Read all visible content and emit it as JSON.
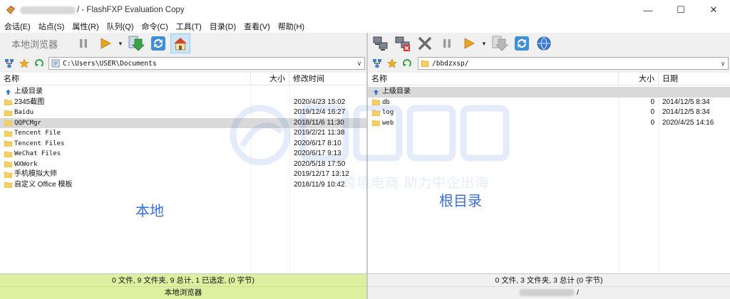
{
  "window": {
    "title": "/ - FlashFXP Evaluation Copy",
    "controls": [
      "—",
      "☐",
      "✕"
    ]
  },
  "menu": [
    "会话(E)",
    "站点(S)",
    "属性(R)",
    "队列(Q)",
    "命令(C)",
    "工具(T)",
    "目录(D)",
    "查看(V)",
    "帮助(H)"
  ],
  "colors": {
    "accent": "#3b6fd6",
    "status_left": "#dcf0a0",
    "selected_row": "#d9d9d9",
    "folder": "#f5cf63"
  },
  "left": {
    "toolbar_label": "本地浏览器",
    "path": "C:\\Users\\USER\\Documents",
    "columns": {
      "name": "名称",
      "size": "大小",
      "modified": "修改时间"
    },
    "rows": [
      {
        "name": "上级目录",
        "size": "",
        "date": "",
        "type": "up"
      },
      {
        "name": "2345截图",
        "size": "",
        "date": "2020/4/23 15:02",
        "type": "folder"
      },
      {
        "name": "Baidu",
        "size": "",
        "date": "2019/12/4 16:27",
        "type": "folder"
      },
      {
        "name": "QQPCMgr",
        "size": "",
        "date": "2018/11/6 11:30",
        "type": "folder",
        "selected": true
      },
      {
        "name": "Tencent File",
        "size": "",
        "date": "2019/2/21 11:38",
        "type": "folder"
      },
      {
        "name": "Tencent Files",
        "size": "",
        "date": "2020/6/17 8:10",
        "type": "folder"
      },
      {
        "name": "WeChat Files",
        "size": "",
        "date": "2020/6/17 9:13",
        "type": "folder"
      },
      {
        "name": "WXWork",
        "size": "",
        "date": "2020/5/18 17:50",
        "type": "folder"
      },
      {
        "name": "手机模拟大师",
        "size": "",
        "date": "2019/12/17 13:12",
        "type": "folder"
      },
      {
        "name": "自定义 Office 模板",
        "size": "",
        "date": "2018/11/9 10:42",
        "type": "folder"
      }
    ],
    "overlay": "本地",
    "status_line1": "0 文件, 9 文件夹, 9 总计, 1 已选定, (0 字节)",
    "status_line2": "本地浏览器"
  },
  "right": {
    "path": "/bbdzxsp/",
    "columns": {
      "name": "名称",
      "size": "大小",
      "date": "日期"
    },
    "rows": [
      {
        "name": "上级目录",
        "size": "",
        "date": "",
        "type": "up",
        "selected": true
      },
      {
        "name": "db",
        "size": "0",
        "date": "2014/12/5 8:34",
        "type": "folder"
      },
      {
        "name": "log",
        "size": "0",
        "date": "2014/12/5 8:34",
        "type": "folder"
      },
      {
        "name": "web",
        "size": "0",
        "date": "2020/4/25 14:16",
        "type": "folder"
      }
    ],
    "overlay": "根目录",
    "status_line1": "0 文件, 3 文件夹, 3 总计 (0 字节)",
    "status_line2_suffix": "/"
  },
  "watermark": {
    "line1": "跨境电商  助力中企出海"
  }
}
